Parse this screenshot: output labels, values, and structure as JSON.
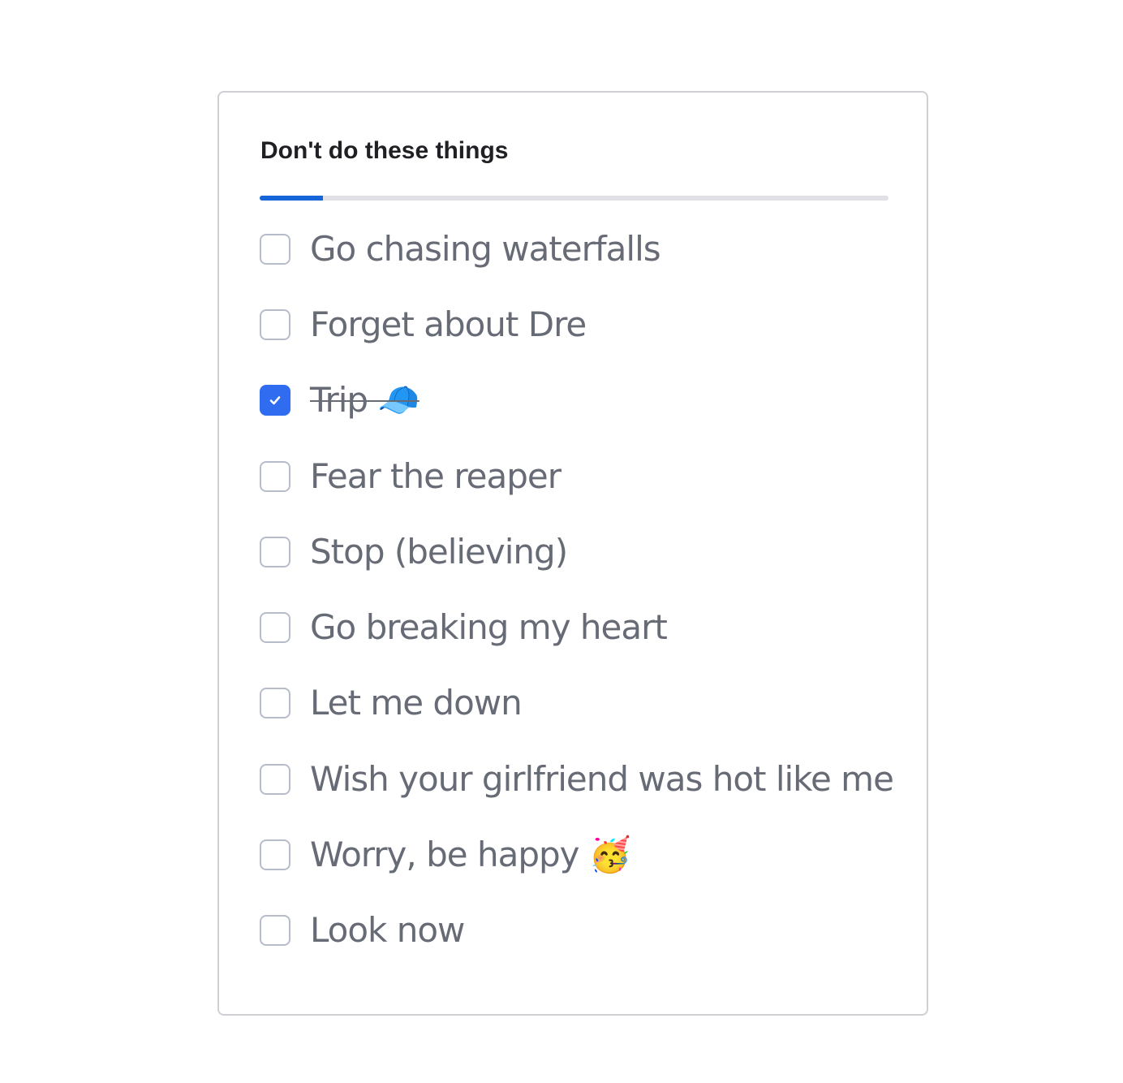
{
  "card": {
    "title": "Don't do these things",
    "progress": 0.1
  },
  "colors": {
    "accent": "#2f6cf0",
    "progress_fill": "#1565d8",
    "progress_track": "#e0e0e6",
    "text": "#676b76",
    "checkbox_border": "#b7bccb"
  },
  "items": [
    {
      "label": "Go chasing waterfalls",
      "checked": false
    },
    {
      "label": "Forget about Dre",
      "checked": false
    },
    {
      "label": "Trip 🧢",
      "checked": true
    },
    {
      "label": "Fear the reaper",
      "checked": false
    },
    {
      "label": "Stop (believing)",
      "checked": false
    },
    {
      "label": "Go breaking my heart",
      "checked": false
    },
    {
      "label": "Let me down",
      "checked": false
    },
    {
      "label": "Wish your girlfriend was hot like me",
      "checked": false
    },
    {
      "label": "Worry, be happy 🥳",
      "checked": false
    },
    {
      "label": "Look now",
      "checked": false
    }
  ]
}
